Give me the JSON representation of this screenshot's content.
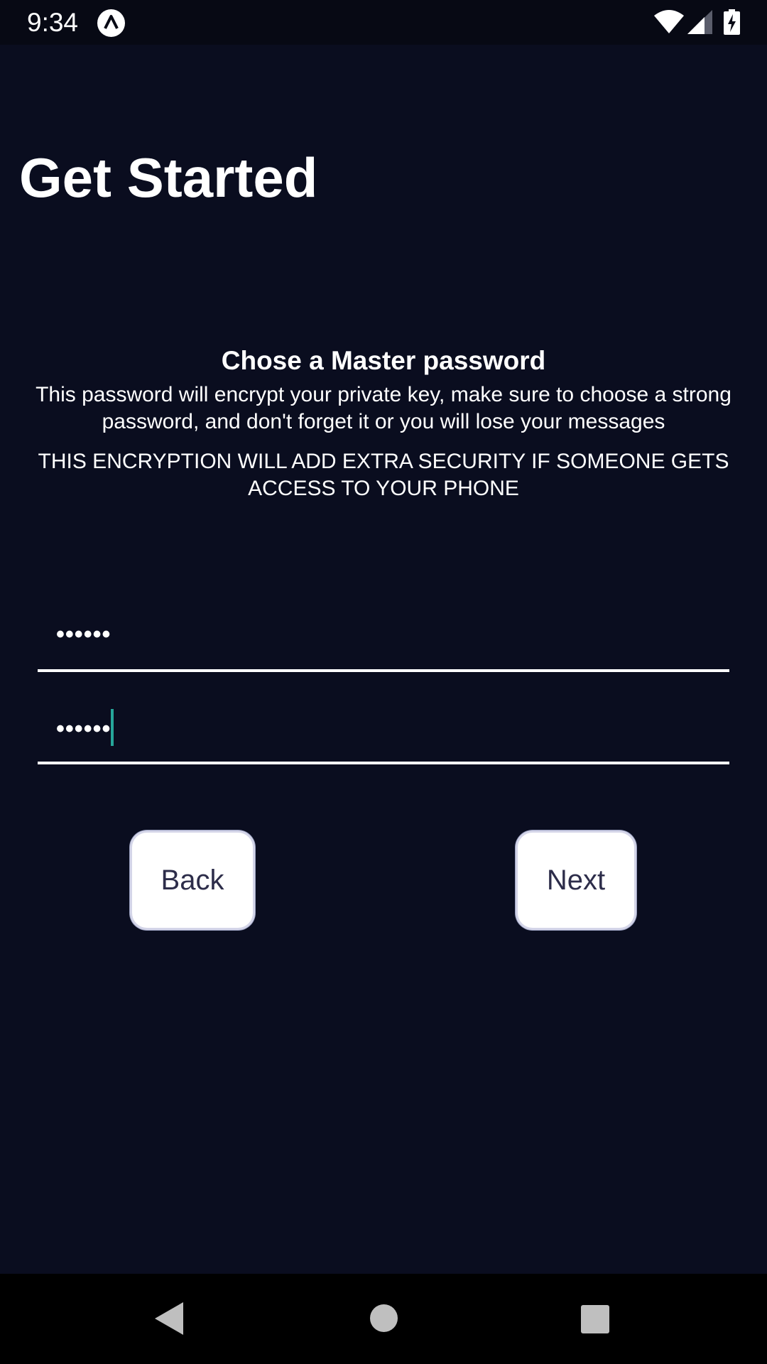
{
  "status_bar": {
    "time": "9:34",
    "icons": [
      "app-notification-icon",
      "wifi-icon",
      "cell-signal-icon",
      "battery-charging-icon"
    ]
  },
  "page": {
    "title": "Get Started"
  },
  "master_password": {
    "heading": "Chose a Master password",
    "description": "This password will encrypt your private key, make sure to choose a strong password, and don't forget it or you will lose your messages",
    "notice": "THIS ENCRYPTION WILL ADD EXTRA SECURITY IF SOMEONE GETS ACCESS TO YOUR PHONE"
  },
  "form": {
    "password_value": "••••••",
    "confirm_password_value": "••••••"
  },
  "buttons": {
    "back_label": "Back",
    "next_label": "Next"
  },
  "nav_bar": {
    "icons": [
      "nav-back-icon",
      "nav-home-icon",
      "nav-recents-icon"
    ]
  },
  "colors": {
    "background": "#0a0d1f",
    "cursor": "#26a69a",
    "button_text": "#2d2d4a"
  }
}
